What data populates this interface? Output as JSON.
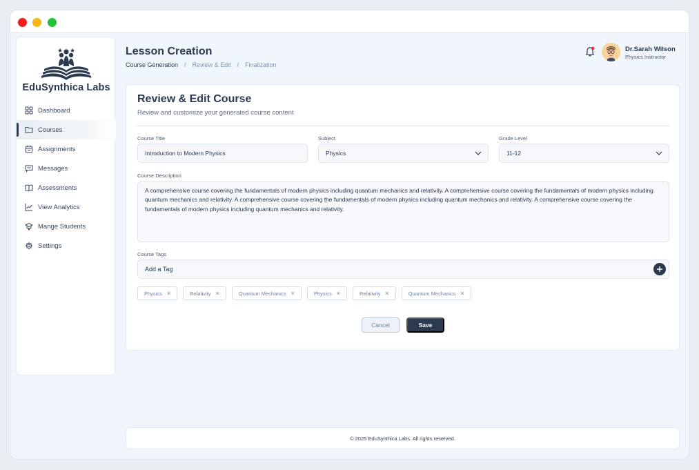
{
  "window": {
    "controls": [
      "close",
      "minimize",
      "maximize"
    ]
  },
  "sidebar": {
    "brand": "EduSynthica Labs",
    "logo_icon": "open-book-people-logo",
    "items": [
      {
        "label": "Dashboard",
        "icon": "grid-icon",
        "active": false
      },
      {
        "label": "Courses",
        "icon": "folder-icon",
        "active": true
      },
      {
        "label": "Assignments",
        "icon": "clipboard-icon",
        "active": false
      },
      {
        "label": "Messages",
        "icon": "message-icon",
        "active": false
      },
      {
        "label": "Assessments",
        "icon": "book-icon",
        "active": false
      },
      {
        "label": "View Analytics",
        "icon": "chart-line-icon",
        "active": false
      },
      {
        "label": "Mange Students",
        "icon": "graduation-cap-icon",
        "active": false
      },
      {
        "label": "Settings",
        "icon": "gear-icon",
        "active": false
      }
    ]
  },
  "header": {
    "title": "Lesson Creation",
    "breadcrumb": [
      "Course Generation",
      "Review & Edit",
      "Finalization"
    ],
    "breadcrumb_sep": "/",
    "user": {
      "name": "Dr.Sarah Wilson",
      "role": "Physics Instructor"
    }
  },
  "card": {
    "title": "Review & Edit Course",
    "subtitle": "Review and customize your generated course content",
    "course_title": {
      "label": "Course Title",
      "value": "Introduction to Modern Physics"
    },
    "subject": {
      "label": "Subject",
      "value": "Physics"
    },
    "grade": {
      "label": "Grade Level",
      "value": "11-12"
    },
    "description": {
      "label": "Course Description",
      "value": "A comprehensive course covering the fundamentals of modern physics including quantum mechanics and relativity. A comprehensive course covering the fundamentals of modern physics including quantum mechanics and relativity. A comprehensive course covering the fundamentals of modern physics including quantum mechanics and relativity. A comprehensive course covering the fundamentals of modern physics including quantum mechanics and relativity."
    },
    "tags": {
      "label": "Course Tags",
      "placeholder": "Add a Tag",
      "items": [
        "Physics",
        "Relativity",
        "Quantum Mechanics",
        "Physics",
        "Relativity",
        "Quantum Mechanics"
      ],
      "remove_glyph": "×"
    },
    "buttons": {
      "cancel": "Cancel",
      "save": "Save"
    }
  },
  "footer": {
    "text": "© 2025 EduSynthica Labs. All rights reserved."
  },
  "colors": {
    "primary": "#2b3a4f",
    "muted": "#7e93b1",
    "background": "#f1f6fc",
    "notification": "#f21c1c"
  }
}
